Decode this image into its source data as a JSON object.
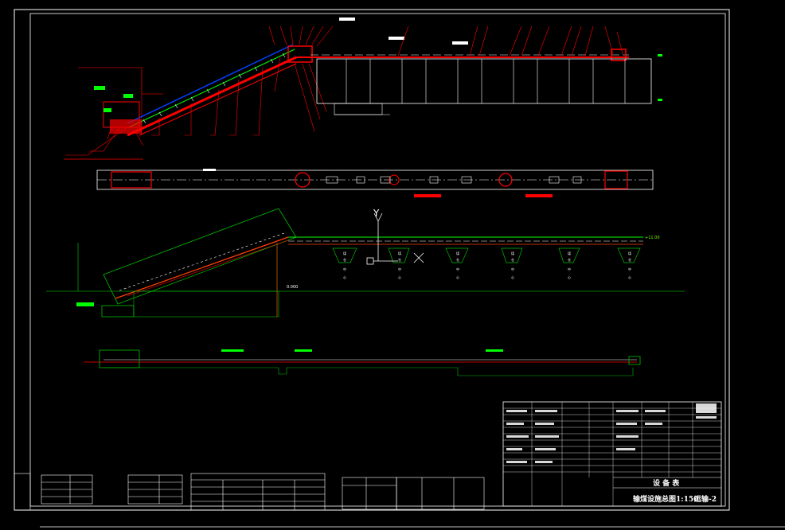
{
  "drawing": {
    "title": "输煤设施总图1:150",
    "sheet": "运输-2",
    "table_heading": "设 备 表",
    "elevation_upper": "+11.00",
    "elevation_ground": "0.000",
    "axis_y": "Y",
    "axis_x": "X",
    "bunker_labels": [
      "煤",
      "仓",
      "中",
      "心"
    ]
  },
  "colors": {
    "background": "#000000",
    "frame": "#ffffff",
    "equipment": "#ff0000",
    "annotation": "#00ff00",
    "belt_top": "#0000ff",
    "structure": "#ffffff",
    "ground": "#00a000"
  }
}
